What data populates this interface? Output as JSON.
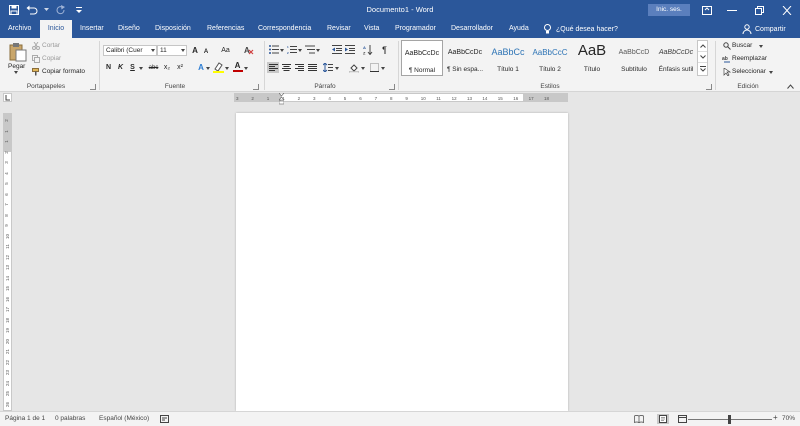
{
  "title_bar": {
    "title": "Documento1  -  Word",
    "signin": "Inic. ses."
  },
  "tabs": [
    {
      "label": "Archivo"
    },
    {
      "label": "Inicio",
      "active": true
    },
    {
      "label": "Insertar"
    },
    {
      "label": "Diseño"
    },
    {
      "label": "Disposición"
    },
    {
      "label": "Referencias"
    },
    {
      "label": "Correspondencia"
    },
    {
      "label": "Revisar"
    },
    {
      "label": "Vista"
    },
    {
      "label": "Programador"
    },
    {
      "label": "Desarrollador"
    },
    {
      "label": "Ayuda"
    }
  ],
  "tell_me": "¿Qué desea hacer?",
  "share": "Compartir",
  "ribbon": {
    "clipboard": {
      "paste": "Pegar",
      "cut": "Cortar",
      "copy": "Copiar",
      "format_painter": "Copiar formato",
      "label": "Portapapeles"
    },
    "font": {
      "font_name": "Calibri (Cuer",
      "font_size": "11",
      "grow": "A",
      "shrink": "A",
      "case": "Aa",
      "bold": "N",
      "italic": "K",
      "underline": "S",
      "strike": "abc",
      "subscript": "x₂",
      "superscript": "x²",
      "effects": "A",
      "font_color": "A",
      "label": "Fuente"
    },
    "paragraph": {
      "pilcrow": "¶",
      "label": "Párrafo"
    },
    "styles": {
      "items": [
        {
          "sample": "AaBbCcDc",
          "name": "¶ Normal"
        },
        {
          "sample": "AaBbCcDc",
          "name": "¶ Sin espa..."
        },
        {
          "sample": "AaBbCc",
          "name": "Título 1"
        },
        {
          "sample": "AaBbCcC",
          "name": "Título 2"
        },
        {
          "sample": "AaB",
          "name": "Título"
        },
        {
          "sample": "AaBbCcD",
          "name": "Subtítulo"
        },
        {
          "sample": "AaBbCcDc",
          "name": "Énfasis sutil"
        }
      ],
      "label": "Estilos"
    },
    "editing": {
      "find": "Buscar",
      "replace": "Reemplazar",
      "select": "Seleccionar",
      "label": "Edición"
    }
  },
  "ruler": {
    "h_numbers": [
      "3",
      "2",
      "1",
      "1",
      "2",
      "3",
      "4",
      "5",
      "6",
      "7",
      "8",
      "9",
      "10",
      "11",
      "12",
      "13",
      "14",
      "15",
      "16",
      "17",
      "18"
    ],
    "v_numbers": [
      "2",
      "1",
      "1",
      "2",
      "3",
      "4",
      "5",
      "6",
      "7",
      "8",
      "9",
      "10",
      "11",
      "12",
      "13",
      "14",
      "15",
      "16",
      "17",
      "18",
      "19",
      "20",
      "21",
      "22",
      "23",
      "24",
      "25",
      "26",
      "27"
    ]
  },
  "status": {
    "page": "Página 1 de 1",
    "words": "0 palabras",
    "language": "Español (México)",
    "zoom": "70%",
    "zoom_minus": "−",
    "zoom_plus": "+"
  },
  "colors": {
    "brand": "#2b579a",
    "highlight": "#ffff00",
    "font_color_bar": "#c00000"
  }
}
